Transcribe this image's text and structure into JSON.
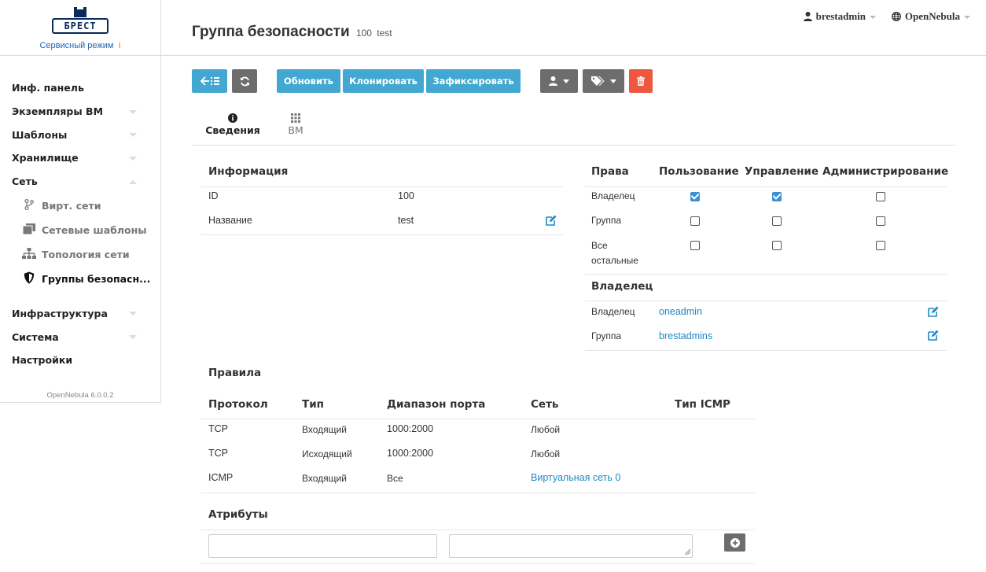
{
  "brand": {
    "logo_text": "БРЕСТ",
    "service_mode": "Сервисный режим",
    "service_mode_icon": "info-icon",
    "version": "OpenNebula 6.0.0.2"
  },
  "sidebar": {
    "items": [
      {
        "label": "Инф. панель",
        "caret": false
      },
      {
        "label": "Экземпляры ВМ",
        "caret": "down"
      },
      {
        "label": "Шаблоны",
        "caret": "down"
      },
      {
        "label": "Хранилище",
        "caret": "down"
      },
      {
        "label": "Сеть",
        "caret": "up"
      }
    ],
    "sub_items": [
      {
        "label": "Вирт. сети",
        "icon": "fork-icon"
      },
      {
        "label": "Сетевые шаблоны",
        "icon": "copy-icon"
      },
      {
        "label": "Топология сети",
        "icon": "sitemap-icon"
      },
      {
        "label": "Группы безопасн...",
        "icon": "shield-icon",
        "active": true
      }
    ],
    "bottom_items": [
      {
        "label": "Инфраструктура",
        "caret": "down"
      },
      {
        "label": "Система",
        "caret": "down"
      },
      {
        "label": "Настройки",
        "caret": false
      }
    ]
  },
  "header": {
    "title": "Группа безопасности",
    "id": "100",
    "name": "test",
    "user": "brestadmin",
    "zone": "OpenNebula"
  },
  "toolbar": {
    "update": "Обновить",
    "clone": "Клонировать",
    "commit": "Зафиксировать"
  },
  "tabs": [
    {
      "label": "Сведения",
      "icon": "info-circle-icon",
      "active": true
    },
    {
      "label": "ВМ",
      "icon": "grid-icon",
      "active": false
    }
  ],
  "info": {
    "title": "Информация",
    "rows": [
      {
        "key": "ID",
        "value": "100"
      },
      {
        "key": "Название",
        "value": "test"
      }
    ]
  },
  "permissions": {
    "headers": [
      "Права",
      "Пользование",
      "Управление",
      "Администрирование"
    ],
    "rows": [
      {
        "label": "Владелец",
        "use": true,
        "manage": true,
        "admin": false
      },
      {
        "label": "Группа",
        "use": false,
        "manage": false,
        "admin": false
      },
      {
        "label": "Все остальные",
        "use": false,
        "manage": false,
        "admin": false
      }
    ]
  },
  "ownership": {
    "title": "Владелец",
    "rows": [
      {
        "key": "Владелец",
        "value": "oneadmin"
      },
      {
        "key": "Группа",
        "value": "brestadmins"
      }
    ]
  },
  "rules": {
    "title": "Правила",
    "headers": [
      "Протокол",
      "Тип",
      "Диапазон порта",
      "Сеть",
      "Тип ICMP"
    ],
    "rows": [
      {
        "protocol": "TCP",
        "type": "Входящий",
        "range": "1000:2000",
        "network": "Любой",
        "network_link": false,
        "icmp": ""
      },
      {
        "protocol": "TCP",
        "type": "Исходящий",
        "range": "1000:2000",
        "network": "Любой",
        "network_link": false,
        "icmp": ""
      },
      {
        "protocol": "ICMP",
        "type": "Входящий",
        "range": "Все",
        "network": "Виртуальная сеть 0",
        "network_link": true,
        "icmp": ""
      }
    ]
  },
  "attributes": {
    "title": "Атрибуты",
    "key_value": "",
    "value_value": ""
  },
  "colors": {
    "accent_blue": "#43a8d1",
    "gray_button": "#6d6d6d",
    "danger_red": "#ec5840",
    "link_blue": "#1f88c6"
  }
}
